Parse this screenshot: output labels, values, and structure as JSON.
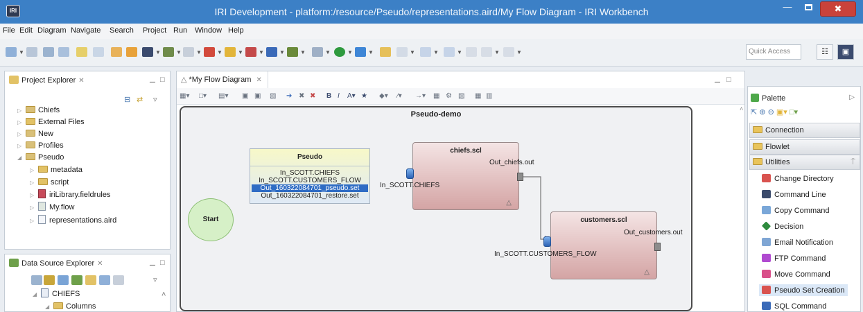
{
  "window": {
    "title": "IRI Development - platform:/resource/Pseudo/representations.aird/My Flow Diagram - IRI Workbench",
    "app_icon_text": "IRI"
  },
  "menu": [
    "File",
    "Edit",
    "Diagram",
    "Navigate",
    "Search",
    "Project",
    "Run",
    "Window",
    "Help"
  ],
  "toolbar": {
    "quick_access_placeholder": "Quick Access"
  },
  "project_explorer": {
    "title": "Project Explorer",
    "items": [
      {
        "label": "Chiefs",
        "indent": 0,
        "expanded": false
      },
      {
        "label": "External Files",
        "indent": 0,
        "expanded": false
      },
      {
        "label": "New",
        "indent": 0,
        "expanded": false
      },
      {
        "label": "Profiles",
        "indent": 0,
        "expanded": false
      },
      {
        "label": "Pseudo",
        "indent": 0,
        "expanded": true
      },
      {
        "label": "metadata",
        "indent": 1,
        "expanded": false
      },
      {
        "label": "script",
        "indent": 1,
        "expanded": false
      },
      {
        "label": "iriLibrary.fieldrules",
        "indent": 1,
        "expanded": false
      },
      {
        "label": "My.flow",
        "indent": 1,
        "expanded": false
      },
      {
        "label": "representations.aird",
        "indent": 1,
        "expanded": false
      }
    ]
  },
  "data_source_explorer": {
    "title": "Data Source Explorer",
    "items": [
      {
        "label": "CHIEFS"
      },
      {
        "label": "Columns"
      }
    ]
  },
  "editor": {
    "tab_label": "*My Flow Diagram",
    "diagram": {
      "container_title": "Pseudo-demo",
      "start_label": "Start",
      "pseudo": {
        "title": "Pseudo",
        "inputs": [
          "In_SCOTT.CHIEFS",
          "In_SCOTT.CUSTOMERS_FLOW"
        ],
        "outputs": [
          "Out_160322084701_pseudo.set",
          "Out_160322084701_restore.set"
        ]
      },
      "chiefs": {
        "title": "chiefs.scl",
        "in_label": "In_SCOTT.CHIEFS",
        "out_label": "Out_chiefs.out"
      },
      "customers": {
        "title": "customers.scl",
        "in_label": "In_SCOTT.CUSTOMERS_FLOW",
        "out_label": "Out_customers.out"
      }
    }
  },
  "palette": {
    "title": "Palette",
    "drawers": [
      "Connection",
      "Flowlet",
      "Utilities"
    ],
    "items": [
      {
        "label": "Change Directory",
        "color": "#d9534f"
      },
      {
        "label": "Command Line",
        "color": "#3a4a6b"
      },
      {
        "label": "Copy Command",
        "color": "#7aa7d8"
      },
      {
        "label": "Decision",
        "color": "#2e8b3e"
      },
      {
        "label": "Email Notification",
        "color": "#7fa6d4"
      },
      {
        "label": "FTP Command",
        "color": "#b04ad0"
      },
      {
        "label": "Move Command",
        "color": "#d94f8a"
      },
      {
        "label": "Pseudo Set Creation",
        "color": "#d9534f"
      },
      {
        "label": "SQL Command",
        "color": "#3a6ab8"
      }
    ]
  }
}
